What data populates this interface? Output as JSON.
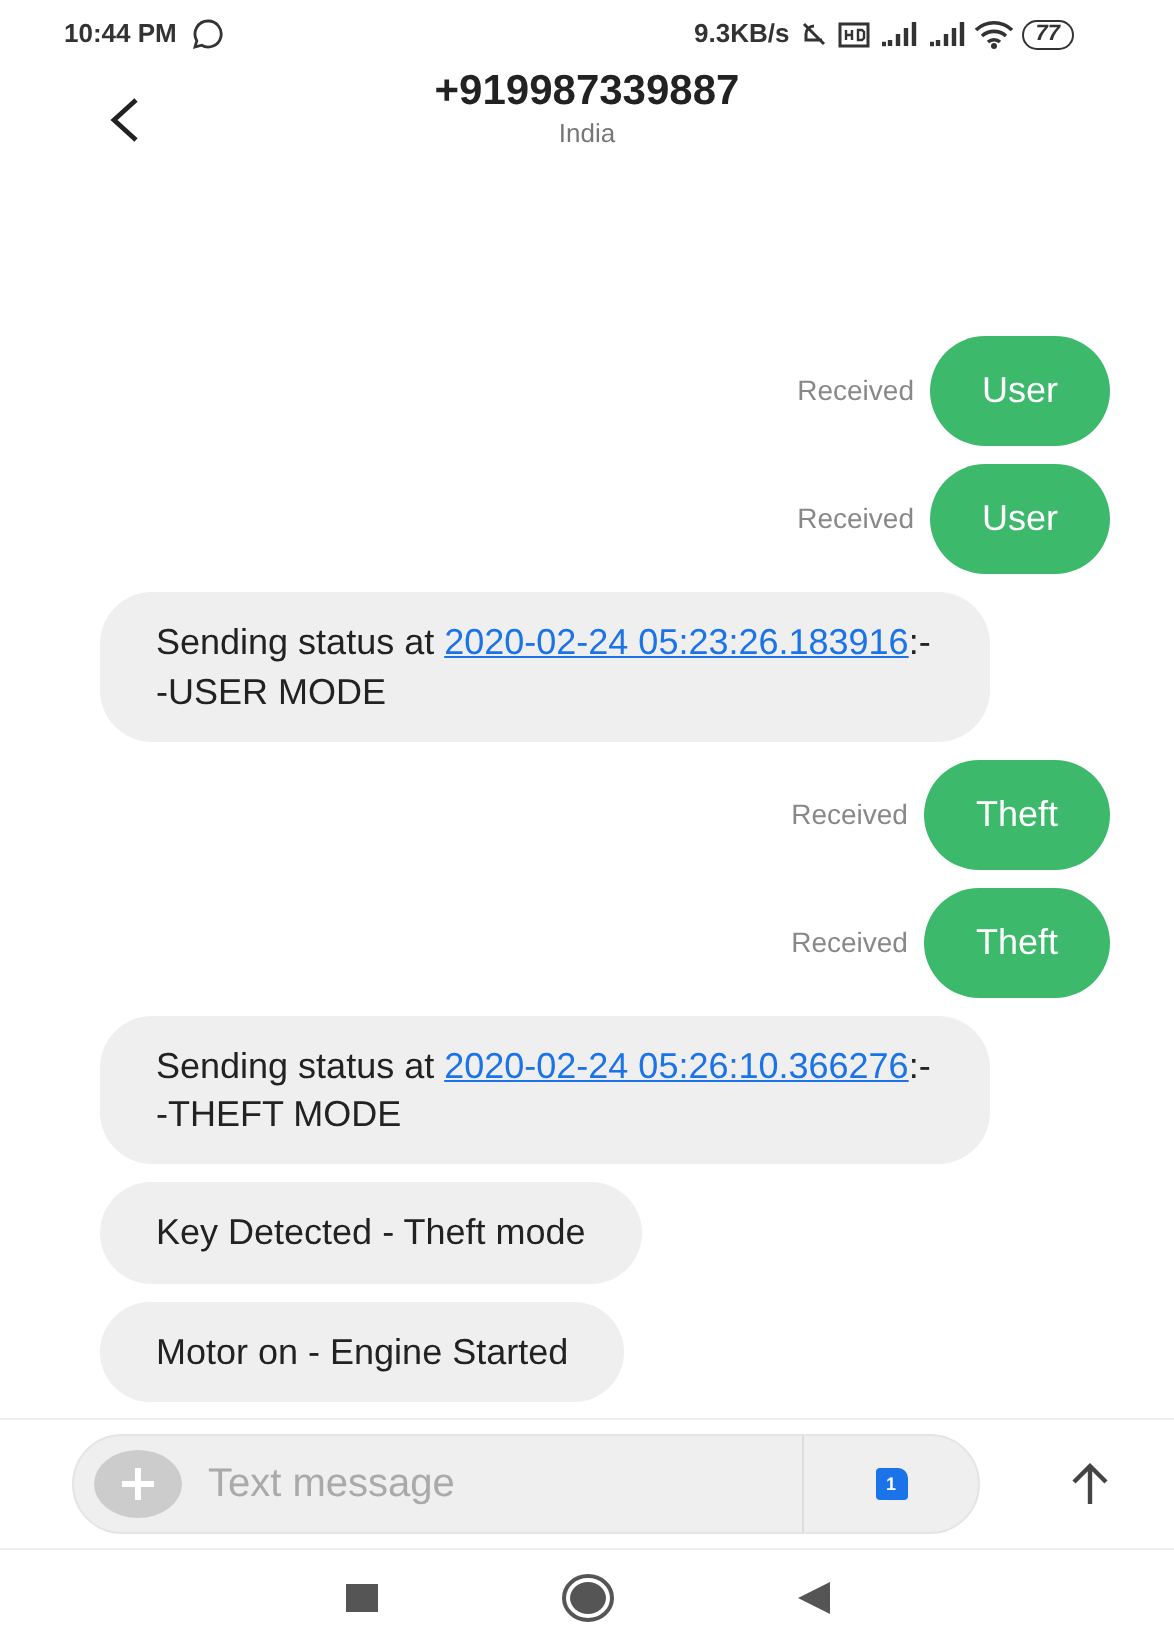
{
  "status_bar": {
    "time": "10:44 PM",
    "speed": "9.3KB/s",
    "battery": "77"
  },
  "header": {
    "title": "+919987339887",
    "subtitle": "India"
  },
  "messages": [
    {
      "kind": "outgoing",
      "status": "Received",
      "parts": [
        {
          "text": "User",
          "link": false
        }
      ]
    },
    {
      "kind": "outgoing",
      "status": "Received",
      "parts": [
        {
          "text": "User",
          "link": false
        }
      ]
    },
    {
      "kind": "incoming",
      "parts": [
        {
          "text": "Sending status at ",
          "link": false
        },
        {
          "text": "2020-02-24 05:23:26.183916",
          "link": true
        },
        {
          "text": ":--USER MODE",
          "link": false
        }
      ]
    },
    {
      "kind": "outgoing",
      "status": "Received",
      "parts": [
        {
          "text": "Theft",
          "link": false
        }
      ]
    },
    {
      "kind": "outgoing",
      "status": "Received",
      "parts": [
        {
          "text": "Theft",
          "link": false
        }
      ]
    },
    {
      "kind": "incoming",
      "parts": [
        {
          "text": "Sending status at ",
          "link": false
        },
        {
          "text": "2020-02-24 05:26:10.366276",
          "link": true
        },
        {
          "text": ":--THEFT MODE",
          "link": false
        }
      ]
    },
    {
      "kind": "incoming",
      "parts": [
        {
          "text": "Key Detected - Theft mode",
          "link": false
        }
      ]
    },
    {
      "kind": "incoming",
      "parts": [
        {
          "text": "Motor on - Engine Started",
          "link": false
        }
      ]
    }
  ],
  "composer": {
    "placeholder": "Text message",
    "sim": "1"
  }
}
